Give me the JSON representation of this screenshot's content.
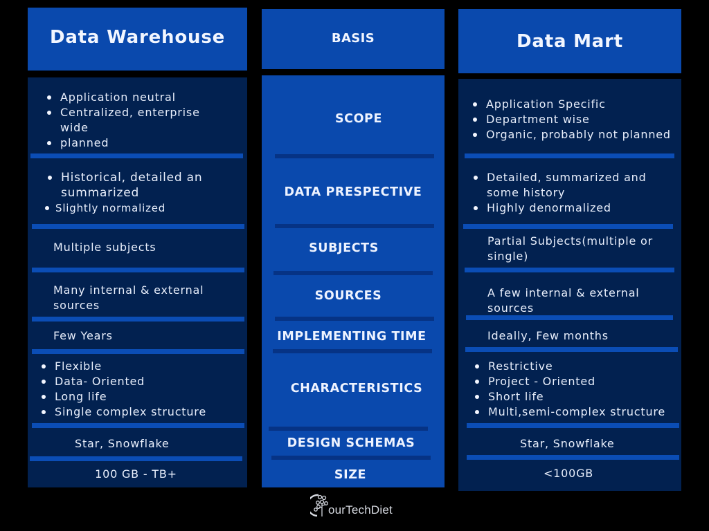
{
  "columns": {
    "left": {
      "title": "Data Warehouse"
    },
    "center": {
      "title": "BASIS"
    },
    "right": {
      "title": "Data Mart"
    }
  },
  "rows": [
    {
      "basis": "SCOPE",
      "warehouse": [
        "Application neutral",
        "Centralized, enterprise wide",
        "planned"
      ],
      "mart": [
        "Application Specific",
        "Department wise",
        "Organic, probably not planned"
      ]
    },
    {
      "basis": "DATA PRESPECTIVE",
      "warehouse": [
        "Historical, detailed an summarized",
        "Slightly normalized"
      ],
      "mart": [
        "Detailed, summarized and some history",
        "Highly denormalized"
      ]
    },
    {
      "basis": "SUBJECTS",
      "warehouse_text": "Multiple subjects",
      "mart_text": "Partial Subjects(multiple or single)"
    },
    {
      "basis": "SOURCES",
      "warehouse_text": "Many internal & external sources",
      "mart_text": "A few internal & external sources"
    },
    {
      "basis": "IMPLEMENTING TIME",
      "warehouse_text": "Few Years",
      "mart_text": "Ideally, Few months"
    },
    {
      "basis": "CHARACTERISTICS",
      "warehouse": [
        "Flexible",
        "Data- Oriented",
        "Long life",
        "Single complex structure"
      ],
      "mart": [
        "Restrictive",
        "Project - Oriented",
        "Short life",
        "Multi,semi-complex structure"
      ]
    },
    {
      "basis": "DESIGN SCHEMAS",
      "warehouse_text": "Star, Snowflake",
      "mart_text": "Star, Snowflake"
    },
    {
      "basis": "SIZE",
      "warehouse_text": "100 GB - TB+",
      "mart_text": "<100GB"
    }
  ],
  "footer": {
    "logo_text": "ourTechDiet",
    "logo_icon": "circuit-tree-icon"
  },
  "colors": {
    "header_blue": "#0a49ad",
    "panel_navy": "#022150",
    "background": "#000000"
  }
}
